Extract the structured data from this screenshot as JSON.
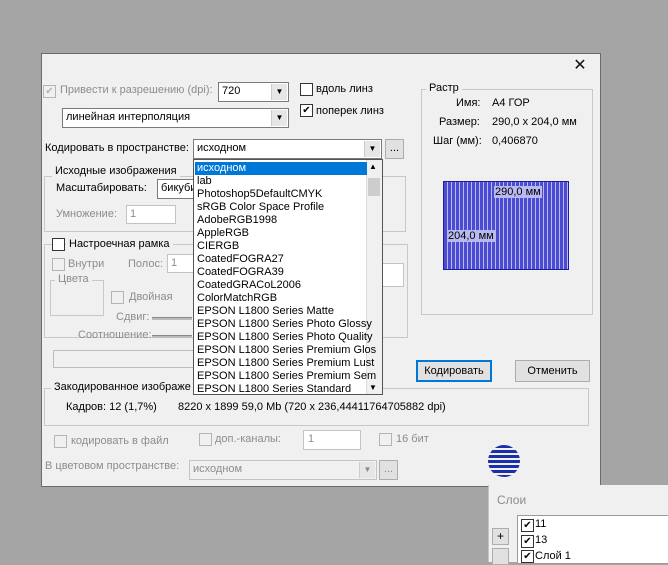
{
  "dialog": {
    "close_glyph": "✕",
    "resolution_label": "Привести к разрешению (dpi):",
    "resolution_value": "720",
    "along_lines_label": "вдоль линз",
    "across_lines_label": "поперек линз",
    "interpolation_value": "линейная интерполяция",
    "encode_space_label": "Кодировать в пространстве:",
    "encode_space_value": "исходном",
    "ellipsis": "...",
    "source_group_title": "Исходные изображения",
    "scale_label": "Масштабировать:",
    "scale_value": "бикуби",
    "multiply_label": "Умножение:",
    "multiply_value": "1",
    "tuning_frame_label": "Настроечная рамка",
    "inside_label": "Внутри",
    "stripes_label": "Полос:",
    "stripes_value": "1",
    "colors_label": "Цвета",
    "double_label": "Двойная",
    "shift_label": "Сдвиг:",
    "ratio_label": "Соотношение:",
    "encoded_group_title": "Закодированное изображе",
    "frames_text": "Кадров:  12 (1,7%)",
    "size_info_text": "8220 x 1899  59,0 Mb (720 x 236,44411764705882 dpi)",
    "encode_to_file_label": "кодировать в файл",
    "extra_channels_label": "доп.-каналы:",
    "extra_channels_value": "1",
    "bit16_label": "16 бит",
    "color_space_label": "В цветовом пространстве:",
    "color_space_value": "исходном",
    "encode_button": "Кодировать",
    "cancel_button": "Отменить"
  },
  "raster": {
    "title": "Растр",
    "name_label": "Имя:",
    "name_value": "A4 ГОР",
    "size_label": "Размер:",
    "size_value": "290,0 x 204,0 мм",
    "step_label": "Шаг (мм):",
    "step_value": "0,406870",
    "width_label": "290,0 мм",
    "height_label": "204,0 мм"
  },
  "dropdown_items": [
    "исходном",
    "lab",
    "Photoshop5DefaultCMYK",
    "sRGB Color Space Profile",
    "AdobeRGB1998",
    "AppleRGB",
    "CIERGB",
    "CoatedFOGRA27",
    "CoatedFOGRA39",
    "CoatedGRACoL2006",
    "ColorMatchRGB",
    "EPSON L1800 Series Matte",
    "EPSON L1800 Series Photo Glossy",
    "EPSON L1800 Series Photo Quality",
    "EPSON L1800 Series Premium Glos",
    "EPSON L1800 Series Premium Lust",
    "EPSON L1800 Series Premium Sem",
    "EPSON L1800 Series Standard"
  ],
  "layers_panel": {
    "title": "Слои",
    "items": [
      "11",
      "13",
      "Слой 1"
    ],
    "add_glyph": "+"
  }
}
